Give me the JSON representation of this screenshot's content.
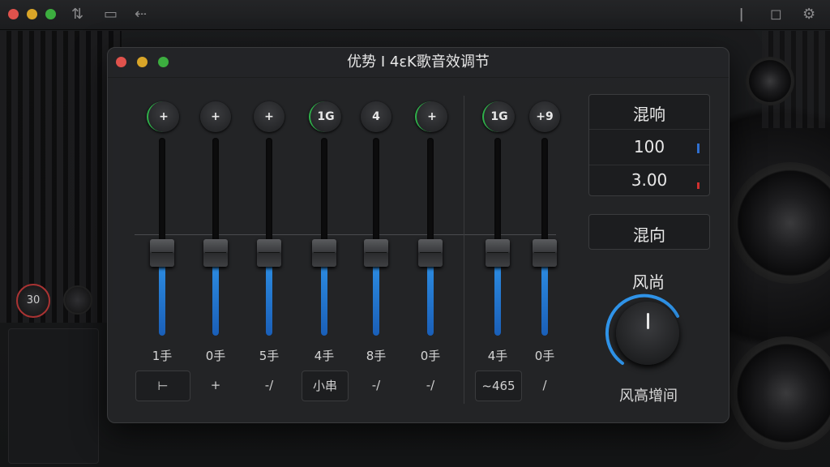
{
  "toolbar": {
    "mixer_icon": "sliders-icon",
    "folder_icon": "folder-icon",
    "back_icon": "back-arrow-icon",
    "info_icon": "info-icon",
    "search_icon": "search-icon",
    "settings_icon": "gear-icon"
  },
  "background": {
    "knob_value": "30"
  },
  "window": {
    "title": "优势 I 4ɛK歌音效调节"
  },
  "channels": [
    {
      "knob": "+",
      "label": "1手",
      "button": "⊢",
      "level": 0.42
    },
    {
      "knob": "+",
      "label": "0手",
      "button": "+",
      "level": 0.42
    },
    {
      "knob": "+",
      "label": "5手",
      "button": "-/",
      "level": 0.42
    },
    {
      "knob": "1G",
      "label": "4手",
      "button": "小串",
      "level": 0.42
    },
    {
      "knob": "4",
      "label": "8手",
      "button": "-/",
      "level": 0.42
    },
    {
      "knob": "+",
      "label": "0手",
      "button": "-/",
      "level": 0.42
    },
    {
      "knob": "1G",
      "label": "4手",
      "button": "~465",
      "level": 0.42
    },
    {
      "knob": "+9",
      "label": "0手",
      "button": "/",
      "level": 0.42
    }
  ],
  "right_panel": {
    "reverb_label": "混响",
    "value1": "100",
    "value2": "3.00",
    "mix_button": "混向",
    "knob_title": "风尚",
    "knob_label": "风高增间"
  },
  "colors": {
    "accent_blue": "#2f93e8",
    "green": "#2fb14a",
    "red": "#d0302f"
  }
}
